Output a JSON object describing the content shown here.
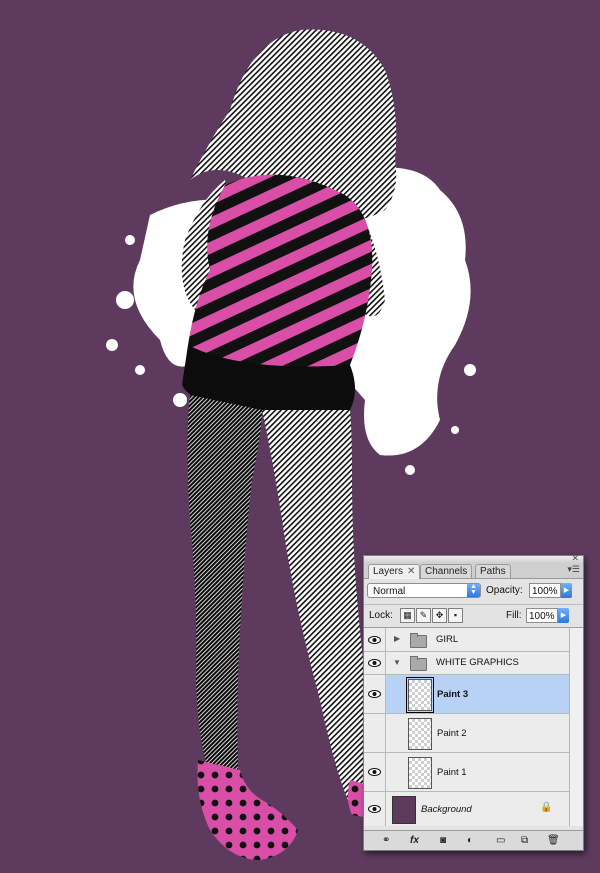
{
  "layers_panel": {
    "tabs": [
      {
        "label": "Layers",
        "active": true
      },
      {
        "label": "Channels",
        "active": false
      },
      {
        "label": "Paths",
        "active": false
      }
    ],
    "blend_mode": "Normal",
    "opacity_label": "Opacity:",
    "opacity_value": "100%",
    "lock_label": "Lock:",
    "fill_label": "Fill:",
    "fill_value": "100%",
    "layers": [
      {
        "name": "GIRL",
        "type": "group",
        "expanded": false,
        "visible": true
      },
      {
        "name": "WHITE GRAPHICS",
        "type": "group",
        "expanded": true,
        "visible": true
      },
      {
        "name": "Paint 3",
        "type": "layer",
        "selected": true,
        "visible": true
      },
      {
        "name": "Paint 2",
        "type": "layer",
        "selected": false,
        "visible": false
      },
      {
        "name": "Paint 1",
        "type": "layer",
        "selected": false,
        "visible": true
      },
      {
        "name": "Background",
        "type": "background",
        "locked": true,
        "visible": true
      }
    ],
    "bottom_icons": [
      "link-icon",
      "fx-icon",
      "mask-icon",
      "adjustment-icon",
      "folder-icon",
      "new-layer-icon",
      "trash-icon"
    ],
    "bottom_fx_label": "fx"
  },
  "colors": {
    "canvas_background": "#5e3b5e",
    "shirt_pink": "#d94fa8",
    "white_graphics": "#ffffff",
    "selection_blue": "#b7d2f5"
  }
}
